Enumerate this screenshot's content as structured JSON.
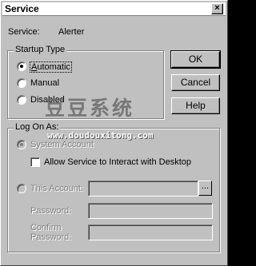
{
  "window": {
    "title": "Service",
    "close_label": "×"
  },
  "service": {
    "label": "Service:",
    "name": "Alerter"
  },
  "startup_type": {
    "legend": "Startup Type",
    "options": [
      {
        "label": "Automatic",
        "selected": true
      },
      {
        "label": "Manual",
        "selected": false
      },
      {
        "label": "Disabled",
        "selected": false
      }
    ]
  },
  "buttons": {
    "ok": "OK",
    "cancel": "Cancel",
    "help": "Help"
  },
  "log_on_as": {
    "legend": "Log On As:",
    "system_account": "System Account",
    "allow_interact": "Allow Service to Interact with Desktop",
    "this_account": "This Account:",
    "browse_label": "...",
    "password_label": "Password:",
    "confirm_label_line1": "Confirm",
    "confirm_label_line2": "Password:"
  },
  "watermark": {
    "chinese": "豆豆系统",
    "url": "www.doudouxitong.com"
  }
}
